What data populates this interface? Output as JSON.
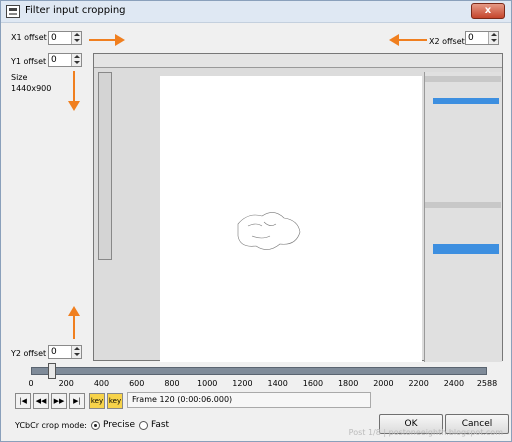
{
  "window": {
    "title": "Filter input cropping",
    "close_label": "x"
  },
  "offsets": {
    "x1_label": "X1 offset",
    "x1_value": "0",
    "y1_label": "Y1 offset",
    "y1_value": "0",
    "x2_label": "X2 offset",
    "x2_value": "0",
    "y2_label": "Y2 offset",
    "y2_value": "0"
  },
  "size": {
    "label": "Size",
    "value": "1440x900"
  },
  "slider": {
    "ticks": [
      "0",
      "200",
      "400",
      "600",
      "800",
      "1000",
      "1200",
      "1400",
      "1600",
      "1800",
      "2000",
      "2200",
      "2400",
      "2588"
    ],
    "position": 120,
    "max": 2588
  },
  "transport": {
    "buttons": [
      "|◀",
      "◀◀",
      "▶▶",
      "▶|",
      "key",
      "key"
    ]
  },
  "frame_info": "Frame 120 (0:00:06.000)",
  "crop_mode": {
    "label": "YCbCr crop mode:",
    "options": [
      "Precise",
      "Fast"
    ],
    "selected": "Precise"
  },
  "buttons": {
    "ok": "OK",
    "cancel": "Cancel"
  },
  "watermark": "Post 1/8 | postoneeighth.blogspot.com",
  "colors": {
    "accent_arrow": "#f07f1f",
    "titlebar": "#dfe8f3",
    "close": "#c4452c"
  }
}
